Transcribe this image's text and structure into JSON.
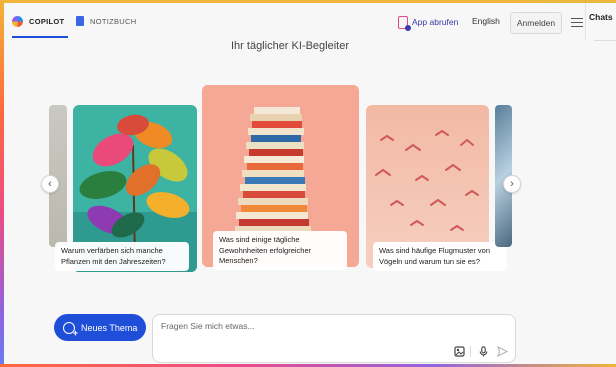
{
  "header": {
    "tabs": [
      {
        "label": "COPILOT",
        "active": true
      },
      {
        "label": "NOTIZBUCH",
        "active": false
      }
    ],
    "get_app": "App abrufen",
    "language": "English",
    "sign_in": "Anmelden",
    "chats": "Chats"
  },
  "subtitle": "Ihr täglicher KI-Begleiter",
  "carousel": {
    "cards": [
      {
        "caption": "Warum verfärben sich manche Pflanzen mit den Jahreszeiten?",
        "image": "colorful-leaves"
      },
      {
        "caption": "Was sind einige tägliche Gewohnheiten erfolgreicher Menschen?",
        "image": "stack-of-books"
      },
      {
        "caption": "Was sind häufige Flugmuster von Vögeln und warum tun sie es?",
        "image": "flying-birds"
      }
    ],
    "prev_icon": "chevron-left-icon",
    "next_icon": "chevron-right-icon"
  },
  "composer": {
    "new_topic": "Neues Thema",
    "placeholder": "Fragen Sie mich etwas...",
    "icons": [
      "image-search-icon",
      "microphone-icon",
      "send-icon"
    ]
  },
  "colors": {
    "accent": "#1f4fd8",
    "featured_card": "#f5a896"
  }
}
